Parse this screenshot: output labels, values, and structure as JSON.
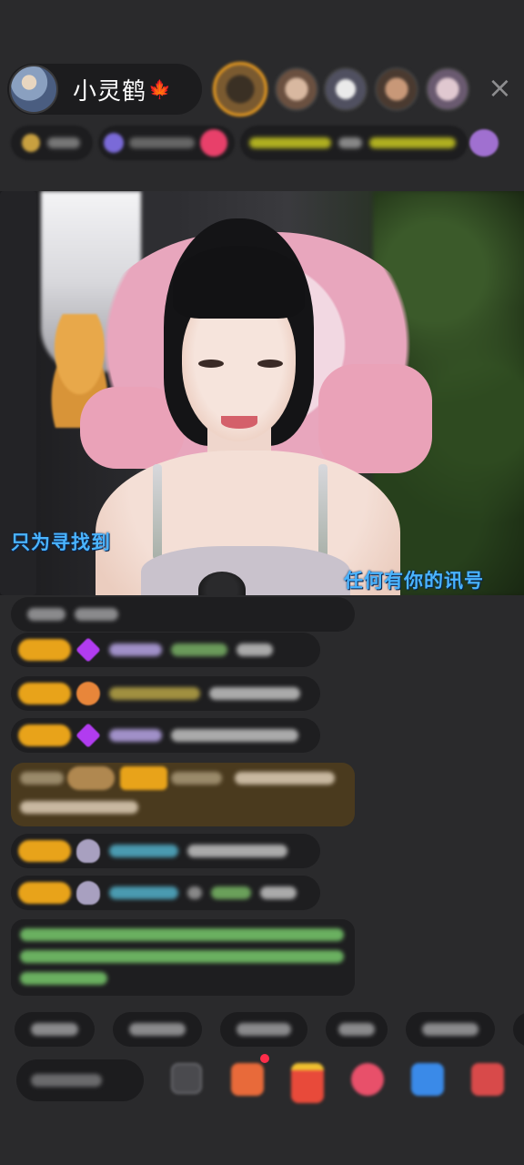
{
  "host": {
    "name": "小灵鹤",
    "name_emoji": "🍁",
    "avatar_icon": "host-avatar"
  },
  "top_viewers": [
    {
      "icon": "viewer-avatar-1",
      "rank": 1
    },
    {
      "icon": "viewer-avatar-2"
    },
    {
      "icon": "viewer-avatar-3"
    },
    {
      "icon": "viewer-avatar-4"
    },
    {
      "icon": "viewer-avatar-5"
    }
  ],
  "close_icon": "×",
  "video": {
    "lyric_left": "只为寻找到",
    "lyric_right": "任何有你的讯号"
  },
  "colors": {
    "background": "#2a2a2c",
    "pill": "#1e1e20",
    "badge_gold": "#e8a31a",
    "lyric_blue": "#4ab4ff",
    "gift_bg": "#4a3a1e",
    "notification_red": "#ff2d4a"
  }
}
